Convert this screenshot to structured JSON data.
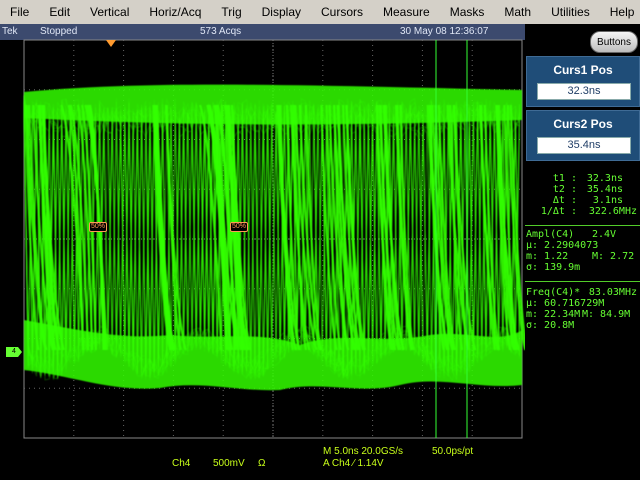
{
  "menu": [
    "File",
    "Edit",
    "Vertical",
    "Horiz/Acq",
    "Trig",
    "Display",
    "Cursors",
    "Measure",
    "Masks",
    "Math",
    "Utilities",
    "Help"
  ],
  "status": {
    "brand": "Tek",
    "run_state": "Stopped",
    "acqs": "573 Acqs",
    "datetime": "30 May 08 12:36:07"
  },
  "buttons_label": "Buttons",
  "curs1": {
    "title": "Curs1 Pos",
    "value": "32.3ns"
  },
  "curs2": {
    "title": "Curs2 Pos",
    "value": "35.4ns"
  },
  "cursor_readout": {
    "t1_label": "t1 :",
    "t1": "32.3ns",
    "t2_label": "t2 :",
    "t2": "35.4ns",
    "dt_label": "Δt :",
    "dt": "3.1ns",
    "inv_label": "1/Δt :",
    "inv": "322.6MHz"
  },
  "ampl": {
    "title": "Ampl(C4)",
    "value": "2.4V",
    "mu": "µ: 2.2904073",
    "m": "m: 1.22",
    "M": "M: 2.72",
    "sigma": "σ: 139.9m"
  },
  "freq": {
    "title": "Freq(C4)*",
    "value": "83.03MHz",
    "mu": "µ: 60.716729M",
    "m": "m: 22.34M",
    "M": "M: 84.9M",
    "sigma": "σ: 20.8M"
  },
  "markers": {
    "ref_label": "50%",
    "channel": "4"
  },
  "bottom": {
    "timebase": "M 5.0ns 20.0GS/s",
    "resolution": "50.0ps/pt",
    "trigger": "A  Ch4  ⁄  1.14V",
    "channel": "Ch4",
    "scale": "500mV",
    "coupling": "Ω"
  },
  "colors": {
    "trace": "#33ff00",
    "menu_bg": "#d4d0c8",
    "status_bg": "#3c4a6e",
    "cursor_box": "#1f4d78",
    "readout": "#66ff33"
  }
}
